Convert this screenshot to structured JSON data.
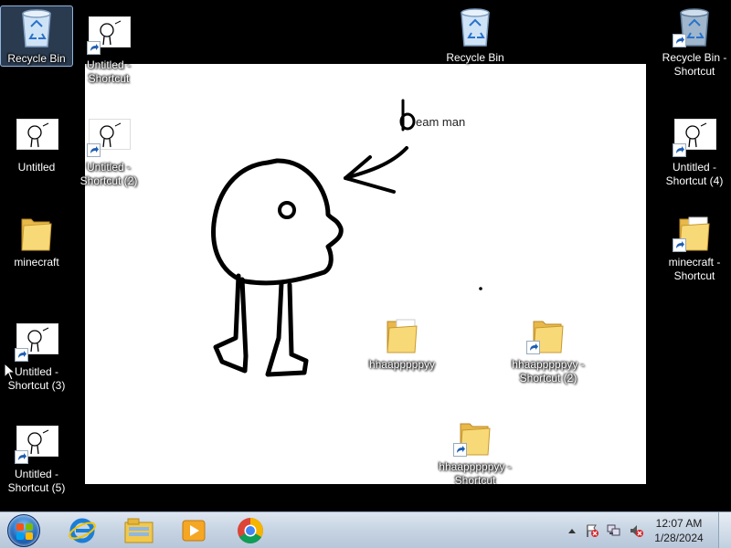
{
  "wallpaper": {
    "caption": "eam man",
    "letter": "b"
  },
  "desktop_icons": [
    {
      "id": "recycle-bin",
      "label": "Recycle Bin",
      "type": "bin",
      "shortcut": false,
      "selected": true
    },
    {
      "id": "untitled-shortcut",
      "label": "Untitled - Shortcut",
      "type": "image",
      "shortcut": true
    },
    {
      "id": "recycle-bin-2",
      "label": "Recycle Bin",
      "type": "bin",
      "shortcut": false
    },
    {
      "id": "recycle-bin-shortcut",
      "label": "Recycle Bin - Shortcut",
      "type": "bin",
      "shortcut": true
    },
    {
      "id": "untitled",
      "label": "Untitled",
      "type": "image",
      "shortcut": false
    },
    {
      "id": "untitled-shortcut-2",
      "label": "Untitled - Shortcut (2)",
      "type": "image",
      "shortcut": true
    },
    {
      "id": "untitled-shortcut-4",
      "label": "Untitled - Shortcut (4)",
      "type": "image",
      "shortcut": true
    },
    {
      "id": "minecraft",
      "label": "minecraft",
      "type": "folder",
      "shortcut": false
    },
    {
      "id": "minecraft-shortcut",
      "label": "minecraft - Shortcut",
      "type": "folder",
      "shortcut": true
    },
    {
      "id": "untitled-shortcut-3",
      "label": "Untitled - Shortcut (3)",
      "type": "image",
      "shortcut": true
    },
    {
      "id": "hhaapppppyy",
      "label": "hhaapppppyy",
      "type": "folder",
      "shortcut": false
    },
    {
      "id": "hhaapppppyy-shortcut-2",
      "label": "hhaapppppyy - Shortcut (2)",
      "type": "folder",
      "shortcut": true
    },
    {
      "id": "untitled-shortcut-5",
      "label": "Untitled - Shortcut (5)",
      "type": "image",
      "shortcut": true
    },
    {
      "id": "hhaapppppyy-shortcut",
      "label": "hhaapppppyy - Shortcut",
      "type": "folder",
      "shortcut": true
    }
  ],
  "taskbar": {
    "pinned": [
      "start-orb",
      "internet-explorer-icon",
      "file-explorer-icon",
      "media-player-icon",
      "chrome-icon"
    ],
    "clock_time": "12:07 AM",
    "clock_date": "1/28/2024",
    "tray_icons": [
      "show-hidden-icons-arrow",
      "action-center-flag-icon",
      "network-icon",
      "volume-muted-icon"
    ]
  },
  "colors": {
    "desktop_bg": "#000000",
    "taskbar_top": "#dde6f0",
    "taskbar_bottom": "#b7c7da",
    "folder_yellow": "#f5d36b",
    "shortcut_arrow": "#1f5fb3",
    "error_red": "#d6262a"
  }
}
